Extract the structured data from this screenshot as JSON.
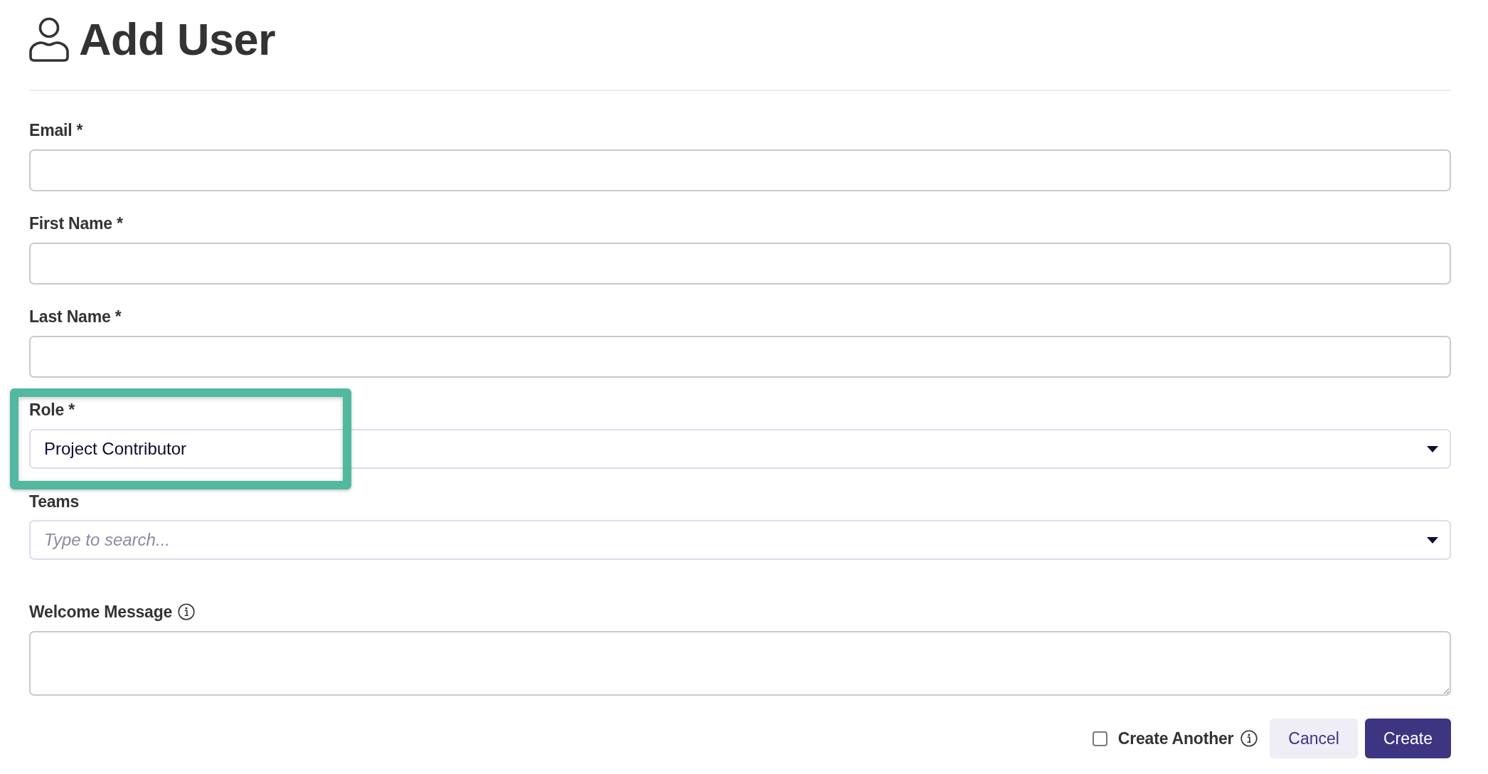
{
  "page": {
    "title": "Add User"
  },
  "fields": [
    {
      "kind": "text",
      "label": "Email *"
    },
    {
      "kind": "text",
      "label": "First Name *"
    },
    {
      "kind": "text",
      "label": "Last Name *"
    },
    {
      "kind": "select",
      "label": "Role *",
      "value": "Project Contributor",
      "highlighted": true
    },
    {
      "kind": "search",
      "label": "Teams",
      "placeholder": "Type to search..."
    },
    {
      "kind": "textarea",
      "label": "Welcome Message",
      "info": true
    }
  ],
  "footer": {
    "create_another": {
      "label": "Create Another",
      "checked": false,
      "info": true
    },
    "buttons": [
      {
        "label": "Cancel",
        "kind": "secondary"
      },
      {
        "label": "Create",
        "kind": "primary"
      }
    ]
  }
}
